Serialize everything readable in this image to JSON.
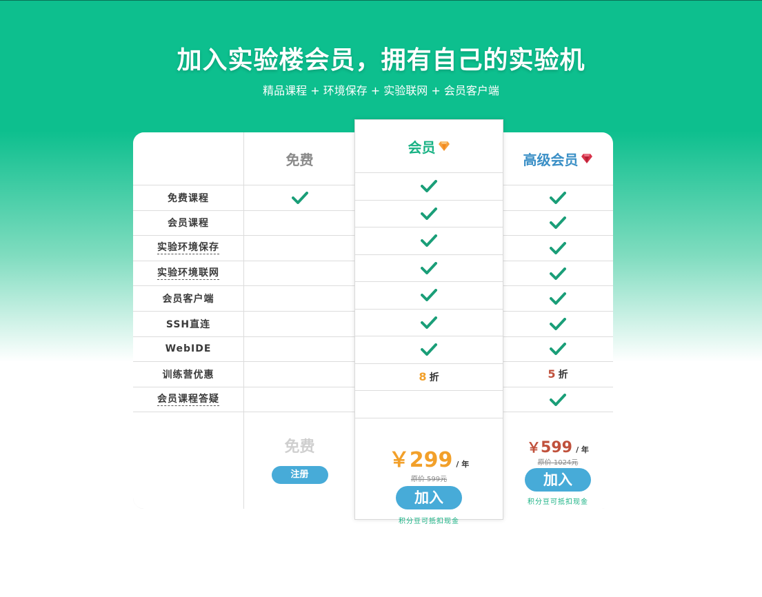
{
  "hero": {
    "title": "加入实验楼会员，拥有自己的实验机",
    "subtitle": "精品课程 + 环境保存 + 实验联网 + 会员客户端"
  },
  "plans": {
    "free": {
      "name": "免费",
      "price_label": "免费",
      "button": "注册"
    },
    "member": {
      "name": "会员",
      "icon": "orange-diamond-icon",
      "currency": "￥",
      "price": "299",
      "per": "/ 年",
      "original": "原价 599元",
      "button": "加入",
      "note": "积分豆可抵扣现金",
      "discount_num": "8",
      "discount_unit": "折"
    },
    "premium": {
      "name": "高级会员",
      "icon": "red-diamond-icon",
      "currency": "￥",
      "price": "599",
      "per": "/ 年",
      "original": "原价 1024元",
      "button": "加入",
      "note": "积分豆可抵扣现金",
      "discount_num": "5",
      "discount_unit": "折"
    }
  },
  "features": [
    {
      "label": "免费课程",
      "dashed": false,
      "free": true,
      "member": true,
      "premium": true
    },
    {
      "label": "会员课程",
      "dashed": false,
      "free": false,
      "member": true,
      "premium": true
    },
    {
      "label": "实验环境保存",
      "dashed": true,
      "free": false,
      "member": true,
      "premium": true
    },
    {
      "label": "实验环境联网",
      "dashed": true,
      "free": false,
      "member": true,
      "premium": true
    },
    {
      "label": "会员客户端",
      "dashed": false,
      "free": false,
      "member": true,
      "premium": true
    },
    {
      "label": "SSH直连",
      "dashed": false,
      "free": false,
      "member": true,
      "premium": true
    },
    {
      "label": "WebIDE",
      "dashed": false,
      "free": false,
      "member": true,
      "premium": true
    },
    {
      "label": "训练营优惠",
      "dashed": false,
      "free": false,
      "member": "discount",
      "premium": "discount"
    },
    {
      "label": "会员课程答疑",
      "dashed": true,
      "free": false,
      "member": false,
      "premium": true
    }
  ],
  "colors": {
    "brand_green": "#0dbf8e",
    "check_green": "#1a9e78",
    "button_blue": "#47abd8",
    "price_orange": "#f2a02a",
    "price_red": "#c0513c"
  }
}
